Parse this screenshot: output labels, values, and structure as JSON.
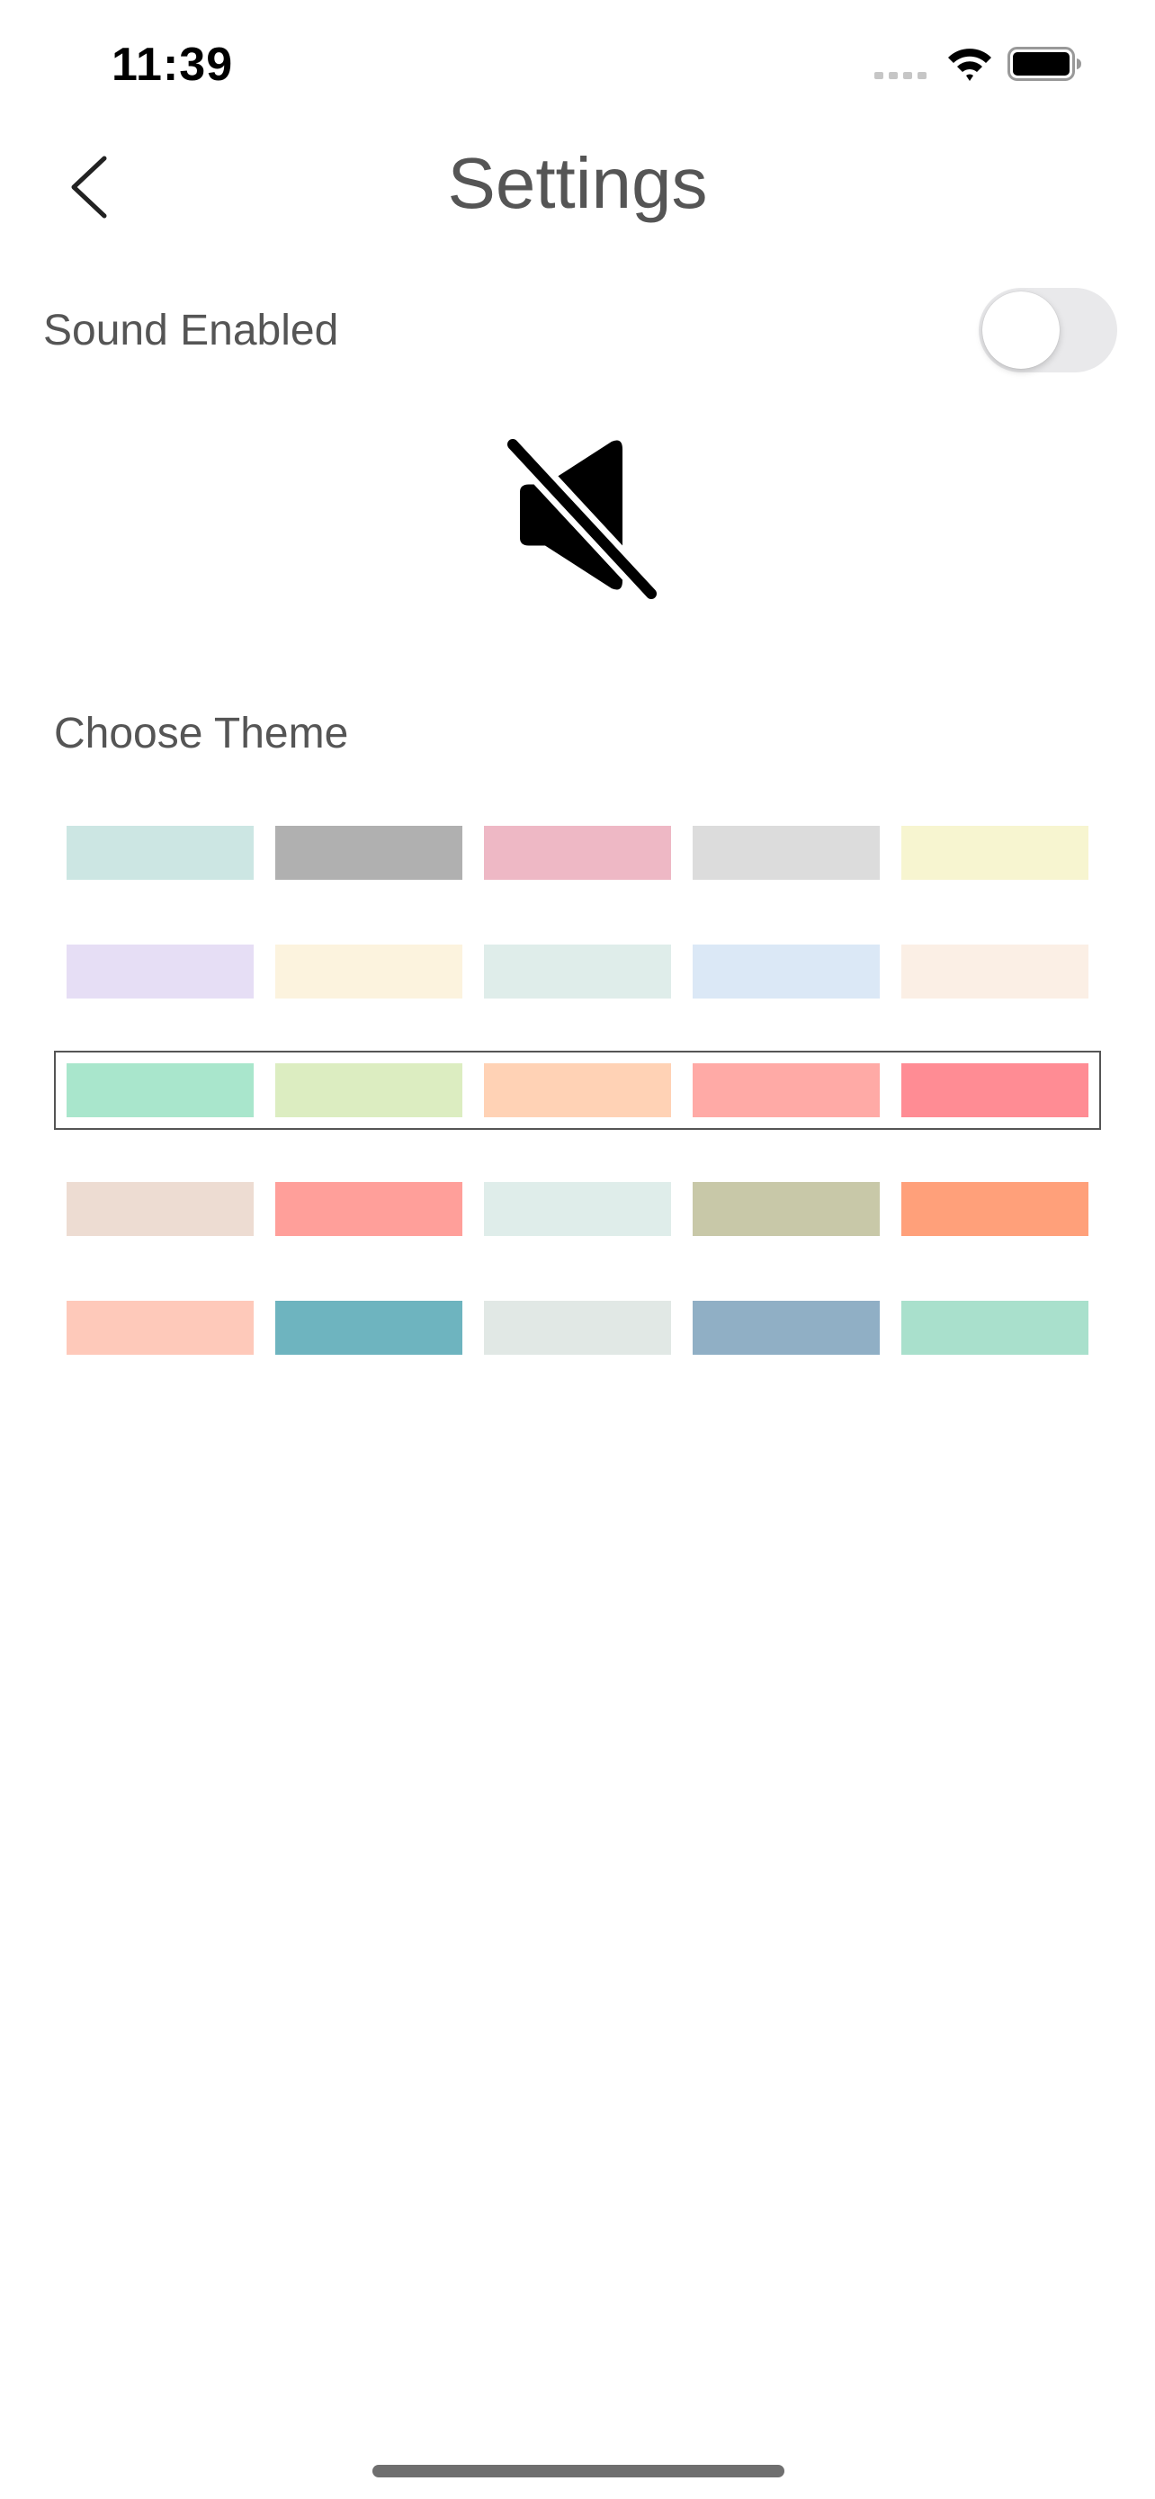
{
  "status_bar": {
    "time": "11:39",
    "signal_icon": "cellular-signal-icon",
    "wifi_icon": "wifi-icon",
    "battery_icon": "battery-full-icon"
  },
  "header": {
    "back_icon": "chevron-left-icon",
    "title": "Settings"
  },
  "sound": {
    "label": "Sound Enabled",
    "enabled": false,
    "status_icon": "speaker-muted-icon"
  },
  "theme": {
    "label": "Choose Theme",
    "selected_row": 2,
    "rows": [
      [
        "#cce6e3",
        "#b0b0b0",
        "#eeb8c5",
        "#dcdcdc",
        "#f7f5d0"
      ],
      [
        "#e6def5",
        "#fcf3de",
        "#dfedea",
        "#dbe8f6",
        "#fbefe5"
      ],
      [
        "#a9e6cc",
        "#dcedc1",
        "#ffd2b5",
        "#ffaaa6",
        "#ff8c94"
      ],
      [
        "#eddcd2",
        "#ff9f9a",
        "#dfedea",
        "#c8c8a8",
        "#ffa07a"
      ],
      [
        "#fec9ba",
        "#6eb4bf",
        "#e1e8e5",
        "#90afc5",
        "#a9e0cc"
      ]
    ]
  }
}
